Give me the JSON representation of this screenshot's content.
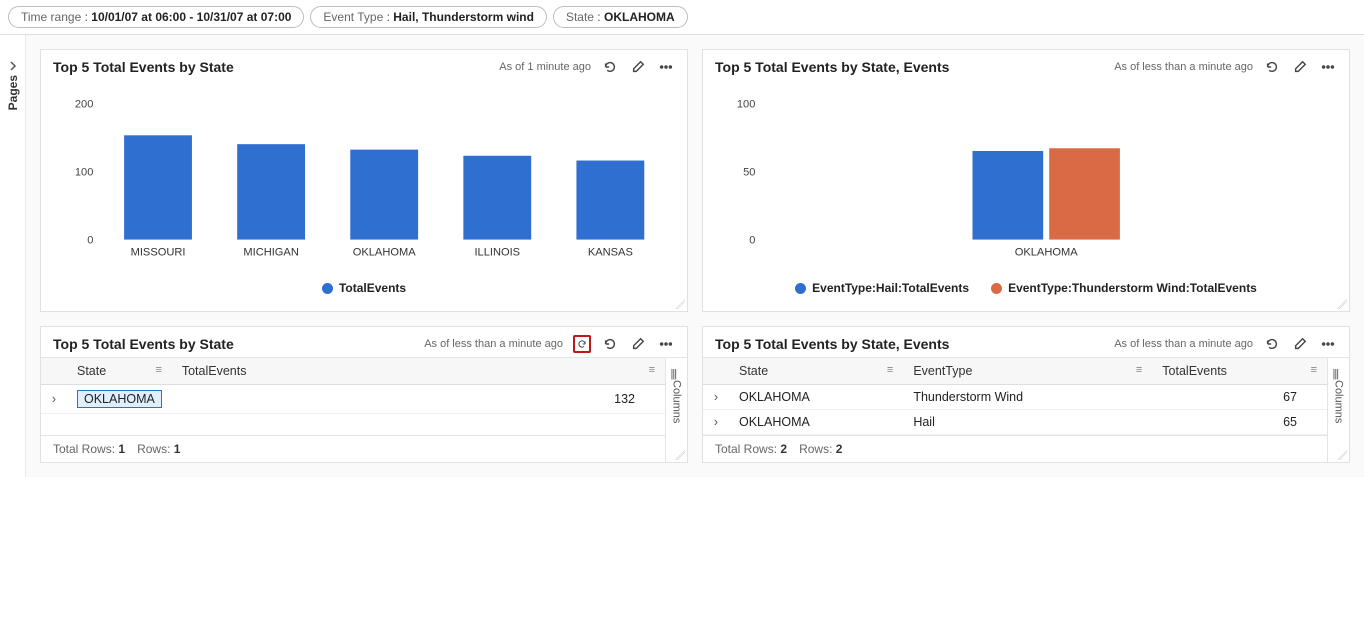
{
  "filters": [
    {
      "key": "Time range",
      "value": "10/01/07 at 06:00 - 10/31/07 at 07:00"
    },
    {
      "key": "Event Type",
      "value": "Hail, Thunderstorm wind"
    },
    {
      "key": "State",
      "value": "OKLAHOMA"
    }
  ],
  "pages_label": "Pages",
  "tiles": {
    "tl": {
      "title": "Top 5 Total Events by State",
      "timestamp": "As of 1 minute ago"
    },
    "tr": {
      "title": "Top 5 Total Events by State, Events",
      "timestamp": "As of less than a minute ago"
    },
    "bl": {
      "title": "Top 5 Total Events by State",
      "timestamp": "As of less than a minute ago",
      "footer_total_label": "Total Rows:",
      "footer_total_val": "1",
      "footer_rows_label": "Rows:",
      "footer_rows_val": "1"
    },
    "br": {
      "title": "Top 5 Total Events by State, Events",
      "timestamp": "As of less than a minute ago",
      "footer_total_label": "Total Rows:",
      "footer_total_val": "2",
      "footer_rows_label": "Rows:",
      "footer_rows_val": "2"
    }
  },
  "chart_data": [
    {
      "id": "tl",
      "type": "bar",
      "title": "Top 5 Total Events by State",
      "categories": [
        "MISSOURI",
        "MICHIGAN",
        "OKLAHOMA",
        "ILLINOIS",
        "KANSAS"
      ],
      "series": [
        {
          "name": "TotalEvents",
          "color": "#2f6fd0",
          "values": [
            153,
            140,
            132,
            123,
            116
          ]
        }
      ],
      "ylabel": "",
      "xlabel": "",
      "yticks": [
        0,
        100,
        200
      ],
      "ylim": [
        0,
        200
      ],
      "legend": [
        "TotalEvents"
      ]
    },
    {
      "id": "tr",
      "type": "bar",
      "title": "Top 5 Total Events by State, Events",
      "categories": [
        "OKLAHOMA"
      ],
      "series": [
        {
          "name": "EventType:Hail:TotalEvents",
          "color": "#2f6fd0",
          "values": [
            65
          ]
        },
        {
          "name": "EventType:Thunderstorm Wind:TotalEvents",
          "color": "#d86b46",
          "values": [
            67
          ]
        }
      ],
      "ylabel": "",
      "xlabel": "",
      "yticks": [
        0,
        50,
        100
      ],
      "ylim": [
        0,
        100
      ],
      "legend": [
        "EventType:Hail:TotalEvents",
        "EventType:Thunderstorm Wind:TotalEvents"
      ]
    }
  ],
  "tables": {
    "bl": {
      "columns": [
        "State",
        "TotalEvents"
      ],
      "rows": [
        {
          "state": "OKLAHOMA",
          "total": 132,
          "selected": true
        }
      ]
    },
    "br": {
      "columns": [
        "State",
        "EventType",
        "TotalEvents"
      ],
      "rows": [
        {
          "state": "OKLAHOMA",
          "etype": "Thunderstorm Wind",
          "total": 67
        },
        {
          "state": "OKLAHOMA",
          "etype": "Hail",
          "total": 65
        }
      ]
    }
  },
  "columns_tab_label": "Columns"
}
